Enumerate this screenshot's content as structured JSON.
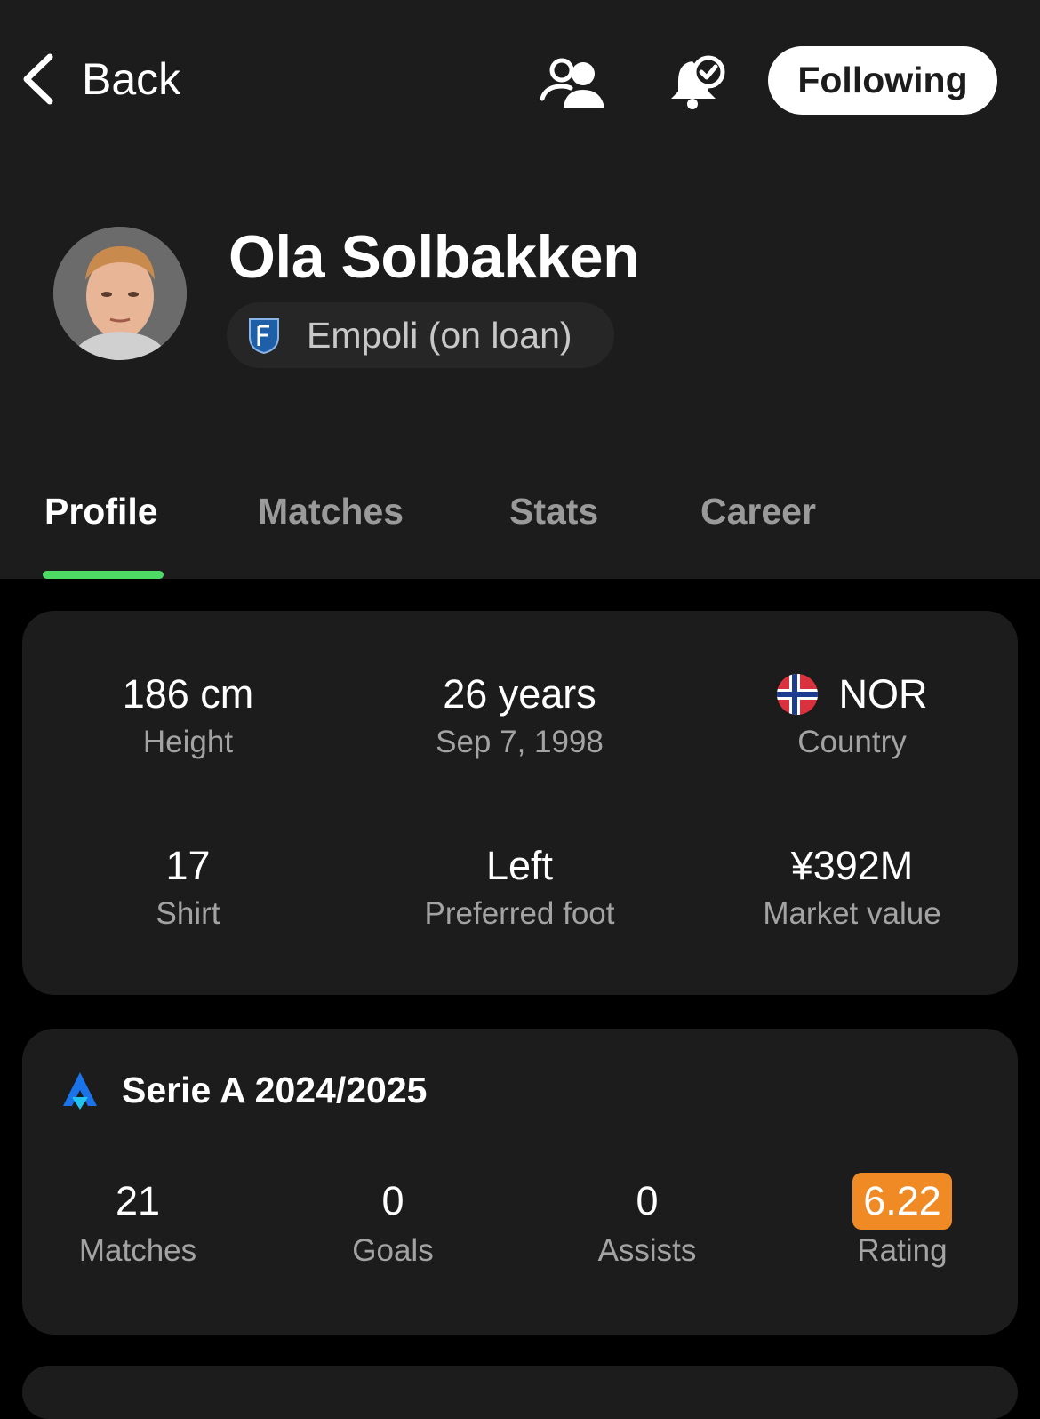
{
  "topbar": {
    "back_label": "Back",
    "follow_label": "Following",
    "icons": [
      "profile-switch-icon",
      "notification-bell-check-icon"
    ]
  },
  "player": {
    "name": "Ola Solbakken",
    "team": "Empoli (on loan)"
  },
  "tabs": [
    {
      "label": "Profile",
      "active": true
    },
    {
      "label": "Matches"
    },
    {
      "label": "Stats"
    },
    {
      "label": "Career"
    }
  ],
  "info": [
    {
      "value": "186 cm",
      "label": "Height"
    },
    {
      "value": "26 years",
      "label": "Sep 7, 1998"
    },
    {
      "value": "NOR",
      "label": "Country"
    },
    {
      "value": "17",
      "label": "Shirt"
    },
    {
      "value": "Left",
      "label": "Preferred foot"
    },
    {
      "value": "¥392M",
      "label": "Market value"
    }
  ],
  "season": {
    "title": "Serie A 2024/2025",
    "stats": [
      {
        "value": "21",
        "label": "Matches"
      },
      {
        "value": "0",
        "label": "Goals"
      },
      {
        "value": "0",
        "label": "Assists"
      },
      {
        "value": "6.22",
        "label": "Rating"
      }
    ]
  },
  "colors": {
    "accent_tab": "#4cd964",
    "rating_badge": "#f08a24",
    "card_bg": "#1c1c1c",
    "page_bg": "#000000"
  }
}
